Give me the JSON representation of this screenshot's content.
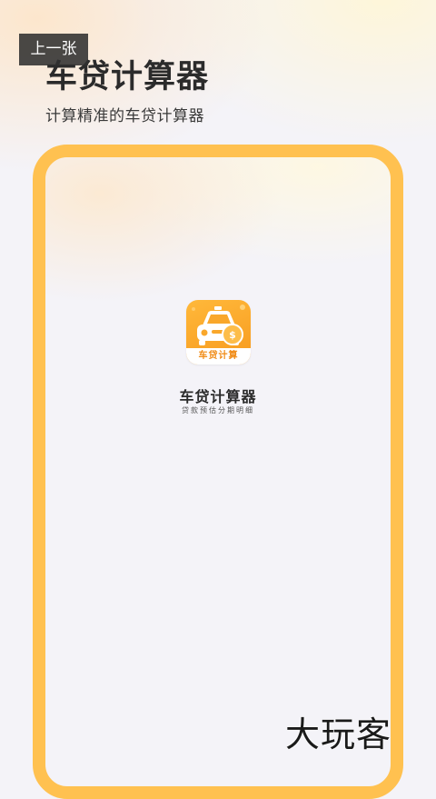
{
  "nav": {
    "prev_label": "上一张"
  },
  "hero": {
    "title": "车贷计算器",
    "subtitle": "计算精准的车贷计算器"
  },
  "app": {
    "icon_label": "车贷计算",
    "name": "车贷计算器",
    "tagline": "贷款预估分期明细"
  },
  "watermark": {
    "text": "大玩客"
  },
  "colors": {
    "frame": "#ffc150",
    "icon_bg": "#f79a1e",
    "background": "#f4f3f8"
  },
  "icons": {
    "app_icon": "car-coin-icon"
  }
}
